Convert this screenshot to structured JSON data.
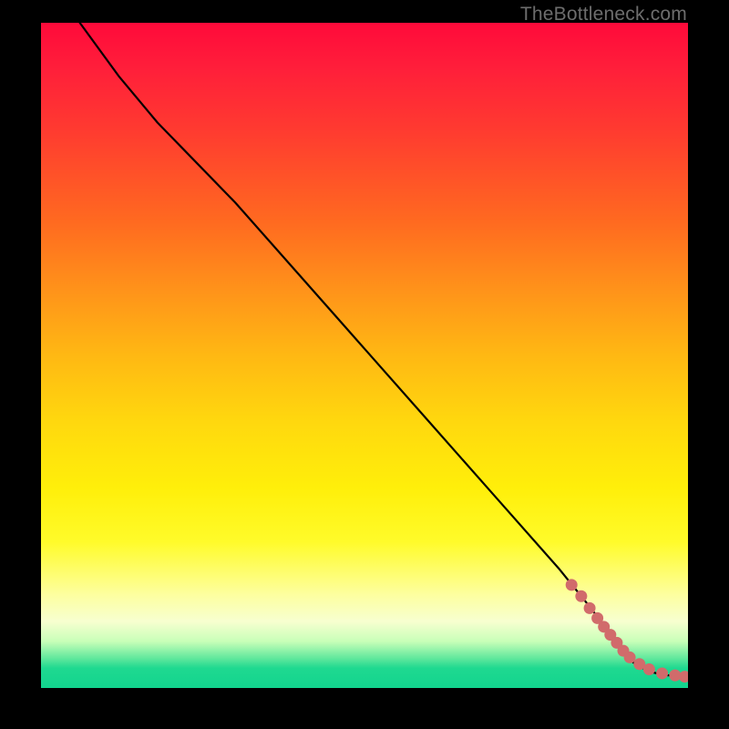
{
  "watermark": "TheBottleneck.com",
  "colors": {
    "dot": "#d16b6b",
    "line": "#000000"
  },
  "chart_data": {
    "type": "line",
    "title": "",
    "xlabel": "",
    "ylabel": "",
    "xlim": [
      0,
      100
    ],
    "ylim": [
      0,
      100
    ],
    "grid": false,
    "series": [
      {
        "name": "curve",
        "style": "line",
        "x": [
          6,
          12,
          18,
          24,
          30,
          40,
          50,
          60,
          70,
          80,
          85,
          88,
          90,
          92,
          94,
          96,
          98,
          100
        ],
        "y": [
          100,
          92,
          85,
          79,
          73,
          62,
          51,
          40,
          29,
          18,
          12,
          8,
          5,
          3.5,
          2.5,
          2,
          1.8,
          1.6
        ]
      },
      {
        "name": "dots",
        "style": "scatter",
        "x": [
          82,
          83.5,
          84.8,
          86,
          87,
          88,
          89,
          90,
          91,
          92.5,
          94,
          96,
          98,
          99.5
        ],
        "y": [
          15.5,
          13.8,
          12,
          10.5,
          9.2,
          8,
          6.8,
          5.6,
          4.6,
          3.6,
          2.8,
          2.2,
          1.9,
          1.7
        ]
      }
    ]
  }
}
